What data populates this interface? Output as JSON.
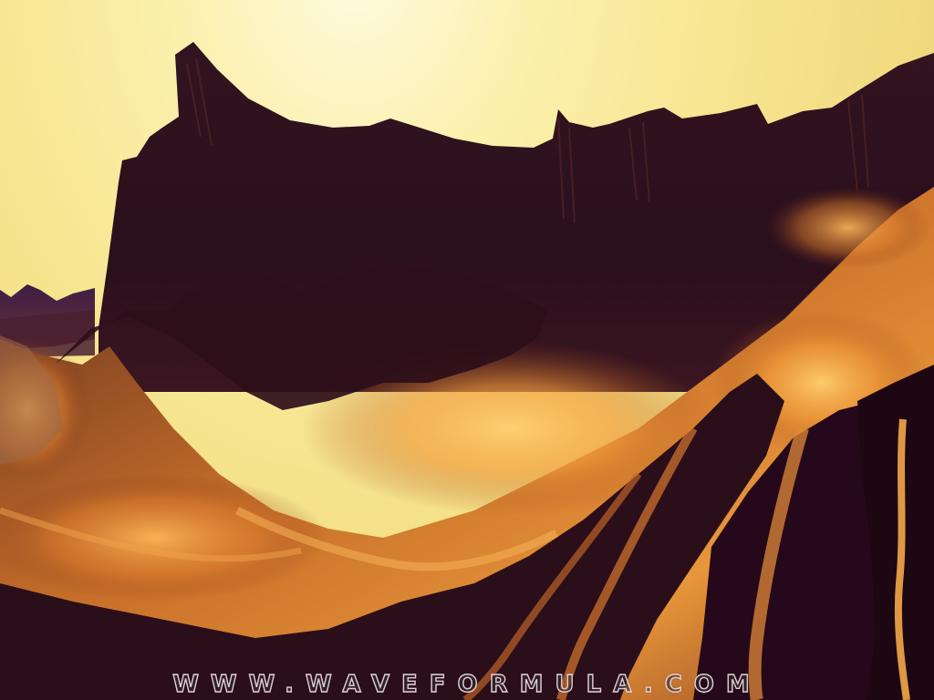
{
  "image": {
    "watermark_text": "www.waveformula.com",
    "colors": {
      "sky_light": "#fbf0ad",
      "sky_mid": "#f6e58e",
      "rock_dark": "#2a0f1c",
      "rock_mid": "#4a1d24",
      "glow_orange": "#e6902f",
      "glow_bright": "#ffc566",
      "distant_purple": "#3d1e44"
    },
    "icons": []
  }
}
